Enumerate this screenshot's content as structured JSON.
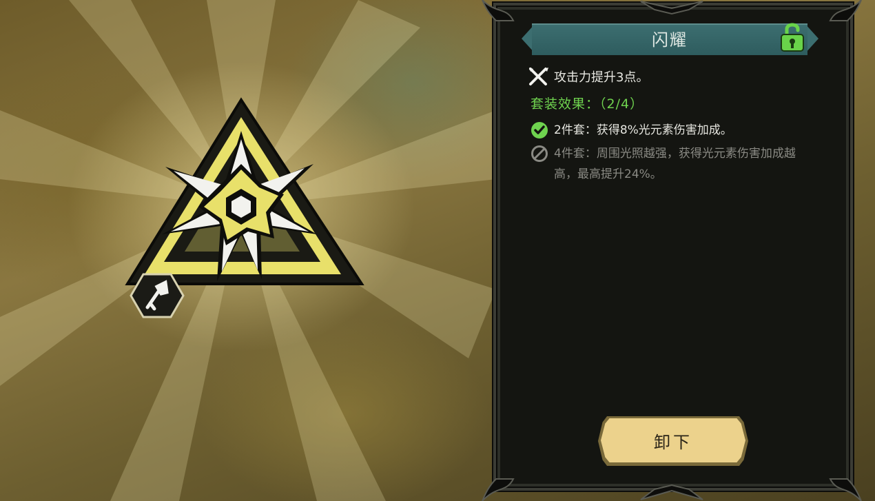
{
  "item": {
    "title": "闪耀",
    "stat_text": "攻击力提升3点。",
    "set_label": "套装效果：",
    "set_count": "（2/4）",
    "bonuses": [
      {
        "text": "2件套：获得8%光元素伤害加成。",
        "active": true
      },
      {
        "text": "4件套：周围光照越强，获得光元素伤害加成越高，最高提升24%。",
        "active": false
      }
    ]
  },
  "actions": {
    "unequip_label": "卸下"
  },
  "icons": {
    "lock": "unlocked-padlock-icon",
    "stat": "crossed-swords-icon",
    "active_bonus": "check-circle-icon",
    "inactive_bonus": "prohibited-circle-icon",
    "emblem": "light-star-emblem-icon",
    "weapon": "weapon-type-icon"
  },
  "colors": {
    "accent_green": "#6fd34f",
    "title_bar": "#3c6e70",
    "button": "#ecd28c",
    "emblem_yellow": "#e8e06a"
  }
}
